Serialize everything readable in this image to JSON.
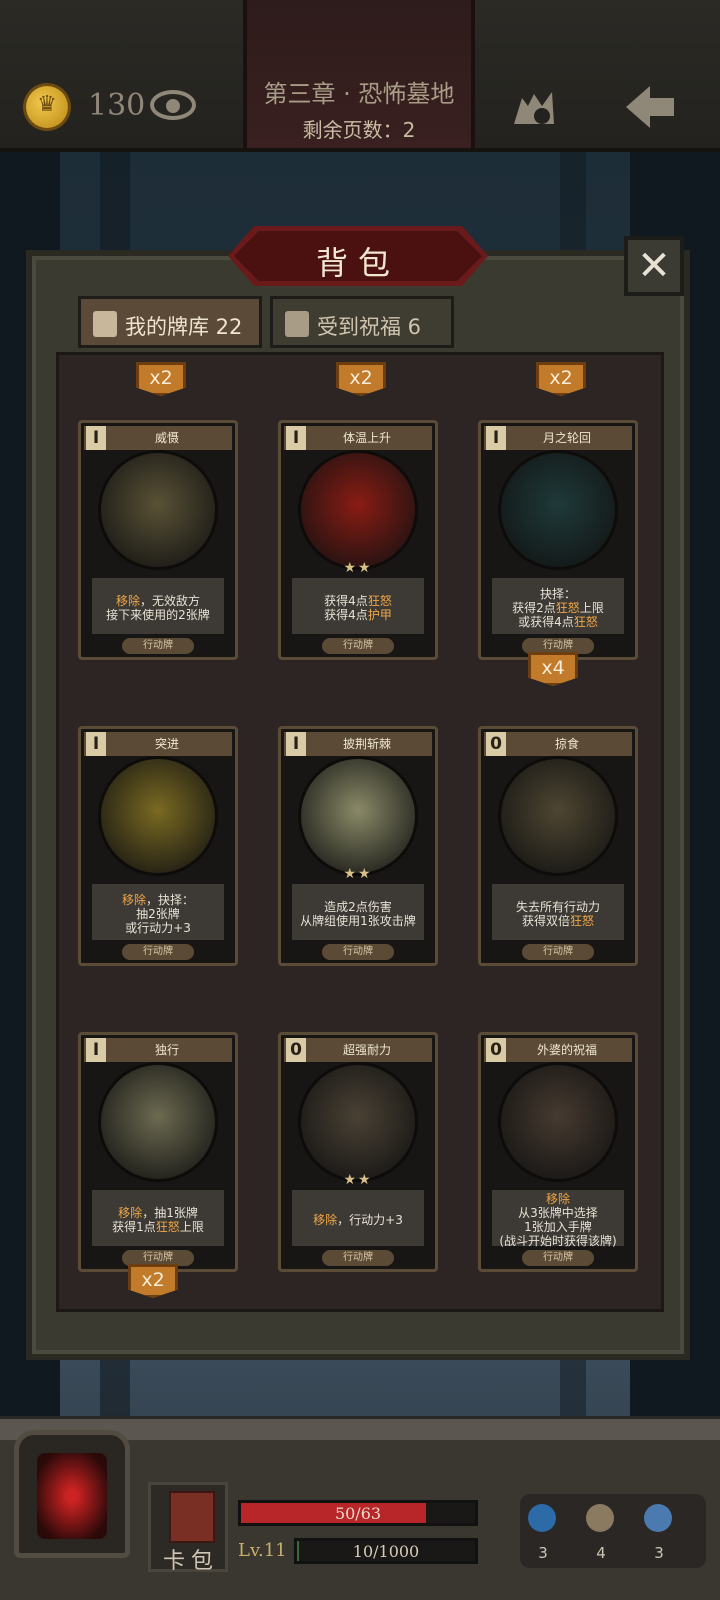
{
  "header": {
    "gold": "130",
    "chapter_title": "第三章 · 恐怖墓地",
    "pages_left": "剩余页数：2"
  },
  "panel": {
    "title": "背包",
    "close_icon": "close-icon",
    "tabs": [
      {
        "label": "我的牌库 22",
        "icon": "cards-icon",
        "active": true
      },
      {
        "label": "受到祝福 6",
        "icon": "gift-icon",
        "active": false
      }
    ]
  },
  "top_row_multipliers": [
    "x2",
    "x2",
    "x2"
  ],
  "cards": [
    {
      "cost": "I",
      "name": "威慑",
      "stars": "",
      "desc": [
        "移除，无效敌方",
        "接下来使用的2张牌"
      ],
      "type": "行动牌",
      "art": "#5a5236",
      "multiplier": ""
    },
    {
      "cost": "I",
      "name": "体温上升",
      "stars": "★★",
      "desc": [
        "获得4点狂怒",
        "获得4点护甲"
      ],
      "type": "行动牌",
      "art": "#8a1c14",
      "multiplier": ""
    },
    {
      "cost": "I",
      "name": "月之轮回",
      "stars": "",
      "desc": [
        "抉择：",
        "获得2点狂怒上限",
        "或获得4点狂怒"
      ],
      "type": "行动牌",
      "art": "#1f3a3a",
      "multiplier": "x4"
    },
    {
      "cost": "I",
      "name": "突进",
      "stars": "",
      "desc": [
        "移除，抉择：",
        "抽2张牌",
        "或行动力+3"
      ],
      "type": "行动牌",
      "art": "#7a6a22",
      "multiplier": ""
    },
    {
      "cost": "I",
      "name": "披荆斩棘",
      "stars": "★★",
      "desc": [
        "造成2点伤害",
        "从牌组使用1张攻击牌"
      ],
      "type": "行动牌",
      "art": "#8a8a68",
      "multiplier": ""
    },
    {
      "cost": "0",
      "name": "掠食",
      "stars": "",
      "desc": [
        "失去所有行动力",
        "获得双倍狂怒"
      ],
      "type": "行动牌",
      "art": "#4e4632",
      "multiplier": ""
    },
    {
      "cost": "I",
      "name": "独行",
      "stars": "",
      "desc": [
        "移除，抽1张牌",
        "获得1点狂怒上限"
      ],
      "type": "行动牌",
      "art": "#6c6a50",
      "multiplier": "x2"
    },
    {
      "cost": "0",
      "name": "超强耐力",
      "stars": "★★",
      "desc": [
        "移除，行动力+3"
      ],
      "type": "行动牌",
      "art": "#4a4134",
      "multiplier": ""
    },
    {
      "cost": "0",
      "name": "外婆的祝福",
      "stars": "",
      "desc": [
        "移除",
        "从3张牌中选择",
        "1张加入手牌",
        "(战斗开始时获得该牌)"
      ],
      "type": "行动牌",
      "art": "#463a30",
      "multiplier": ""
    }
  ],
  "bottom": {
    "deck_label": "卡包",
    "hp_text": "50/63",
    "hp_fraction": 0.79,
    "level": "Lv.11",
    "xp_text": "10/1000",
    "xp_fraction": 0.01,
    "resources": [
      {
        "icon": "potion-icon",
        "count": "3",
        "color": "#2c6aa8"
      },
      {
        "icon": "hourglass-icon",
        "count": "4",
        "color": "#8a7a60"
      },
      {
        "icon": "card-stack-icon",
        "count": "3",
        "color": "#4a7ab0"
      }
    ]
  }
}
